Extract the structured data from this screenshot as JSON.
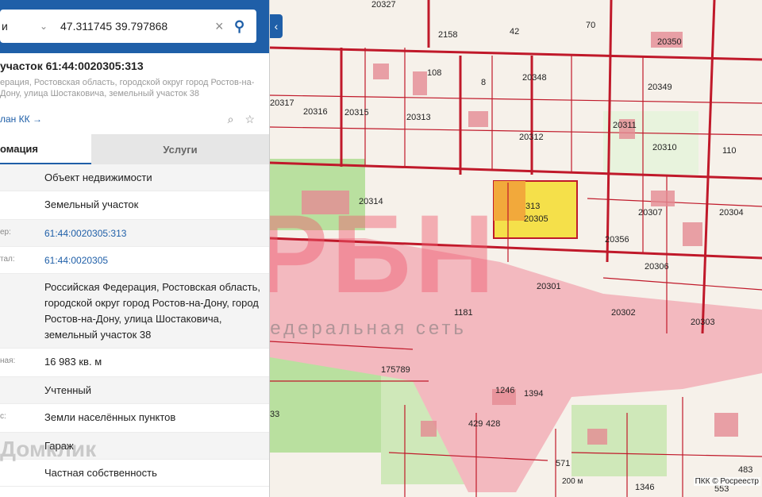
{
  "search": {
    "mode": "и",
    "value": "47.311745 39.797868"
  },
  "object": {
    "title": "участок 61:44:0020305:313",
    "address": "ерация, Ростовская область, городской округ город Ростов-на-Дону, улица Шостаковича, земельный участок 38"
  },
  "plan_link": "лан КК →",
  "tabs": [
    "омация",
    "Услуги"
  ],
  "rows": [
    {
      "label": "",
      "value": "Объект недвижимости"
    },
    {
      "label": "",
      "value": "Земельный участок"
    },
    {
      "label": "ер:",
      "value": "61:44:0020305:313"
    },
    {
      "label": "тал:",
      "value": "61:44:0020305"
    },
    {
      "label": "",
      "value": "Российская Федерация, Ростовская область, городской округ город Ростов-на-Дону, город Ростов-на-Дону, улица Шостаковича, земельный участок 38"
    },
    {
      "label": "ная:",
      "value": "16 983 кв. м"
    },
    {
      "label": "",
      "value": "Учтенный"
    },
    {
      "label": "с:",
      "value": "Земли населённых пунктов"
    },
    {
      "label": "",
      "value": "Гараж"
    },
    {
      "label": "",
      "value": "Частная собственность"
    }
  ],
  "watermarks": {
    "brand": "Домклик",
    "big": "РБН",
    "sub": "Федеральная сеть"
  },
  "map": {
    "labels": [
      "20327",
      "70",
      "20350",
      "20348",
      "20349",
      "20317",
      "20316",
      "20315",
      "20313",
      "20312",
      "20311",
      "20310",
      "20314",
      "313",
      "20305",
      "20307",
      "20304",
      "20356",
      "20306",
      "20301",
      "20302",
      "20303",
      "1181",
      "175789",
      "33",
      "1394",
      "1246",
      "429",
      "428",
      "483",
      "571",
      "1346",
      "553",
      "110",
      "108",
      "8",
      "42",
      "2158"
    ],
    "scale": "200 м",
    "copyright": "ПКК © Росреестр"
  },
  "colors": {
    "accent": "#1f5fa8",
    "parcel_border": "#c0192a",
    "selected_parcel": "#f5e04a",
    "river": "#f3b9bf",
    "green": "#a8d88e"
  }
}
